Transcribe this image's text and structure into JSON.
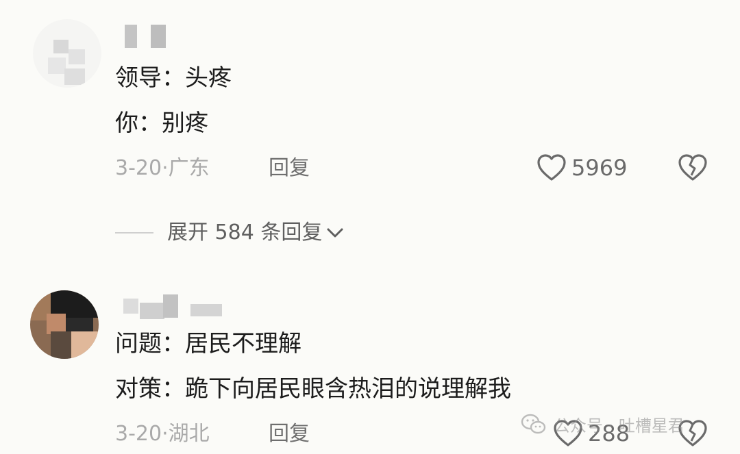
{
  "comments": [
    {
      "lines": [
        "领导：头疼",
        "你：别疼"
      ],
      "meta": "3-20·广东",
      "reply_label": "回复",
      "likes": "5969",
      "expand_label": "展开 584 条回复"
    },
    {
      "lines": [
        "问题：居民不理解",
        "对策：跪下向居民眼含热泪的说理解我"
      ],
      "meta": "3-20·湖北",
      "reply_label": "回复",
      "likes": "288"
    }
  ],
  "watermark": {
    "text": "公众号 · 吐槽星君",
    "icon": "wechat-icon"
  },
  "icons": {
    "like": "heart-outline-icon",
    "dislike": "broken-heart-icon",
    "expand": "chevron-down-icon"
  },
  "colors": {
    "background": "#fbfbf8",
    "text": "#1c1c1c",
    "meta": "#a9a9a9"
  }
}
